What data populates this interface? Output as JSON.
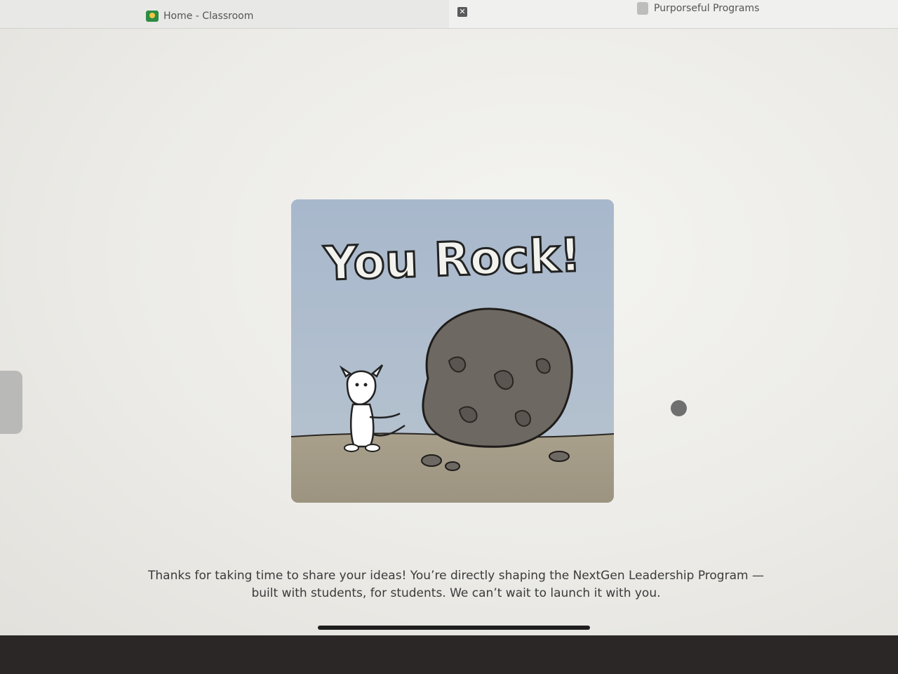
{
  "tabs": [
    {
      "label": "Home - Classroom",
      "icon": "classroom-icon"
    },
    {
      "label": "Purporseful Programs",
      "icon": "document-icon"
    }
  ],
  "close_glyph": "✕",
  "image": {
    "title": "You Rock!",
    "colors": {
      "sky": "#9fb1c6",
      "ground": "#a49d8a",
      "rock": "#6b6660",
      "dog": "#ffffff"
    }
  },
  "message": {
    "line1": "Thanks for taking  time to share your ideas! You’re directly shaping the NextGen Leadership Program —",
    "line2": "built with students, for students. We can’t wait to launch it with you."
  }
}
